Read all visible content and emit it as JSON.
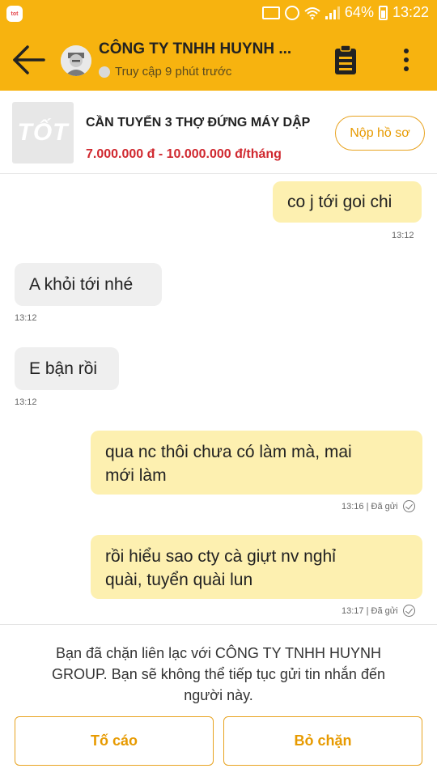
{
  "status_bar": {
    "app_icon_text": "tot",
    "battery": "64%",
    "time": "13:22"
  },
  "header": {
    "title": "CÔNG TY TNHH HUYNH ...",
    "presence": "Truy cập 9 phút trước"
  },
  "job": {
    "logo_text": "TỐT",
    "name": "CẦN TUYỂN 3 THỢ ĐỨNG MÁY DẬP",
    "salary": "7.000.000 đ - 10.000.000 đ/tháng",
    "apply_label": "Nộp hồ sơ"
  },
  "messages": [
    {
      "dir": "out",
      "line1": "co j tới goi chi",
      "line2": "",
      "time": "13:12",
      "status": ""
    },
    {
      "dir": "in",
      "line1": "A khỏi tới nhé",
      "line2": "",
      "time": "13:12",
      "status": ""
    },
    {
      "dir": "in",
      "line1": "E bận rồi",
      "line2": "",
      "time": "13:12",
      "status": ""
    },
    {
      "dir": "out",
      "line1": "qua nc thôi chưa có làm mà, mai",
      "line2": "mới làm",
      "time": "13:16",
      "status": "Đã gửi"
    },
    {
      "dir": "out",
      "line1": "rồi hiểu sao cty cà giựt nv nghỉ",
      "line2": "quài, tuyển quài lun",
      "time": "13:17",
      "status": "Đã gửi"
    }
  ],
  "blocked": {
    "line1": "Bạn đã chặn liên lạc với CÔNG TY TNHH HUYNH",
    "line2": "GROUP. Bạn sẽ không thể tiếp tục gửi tin nhắn đến",
    "line3": "người này.",
    "report_label": "Tố cáo",
    "unblock_label": "Bỏ chặn"
  },
  "icons": {
    "back": "arrow-left-icon",
    "clipboard": "clipboard-icon",
    "more": "more-vertical-icon",
    "sent": "check-circle-icon"
  },
  "colors": {
    "brand": "#f7b30f",
    "salary": "#d0282f",
    "accent_text": "#e79a00",
    "bubble_out": "#fdf0b0",
    "bubble_in": "#efefef"
  }
}
